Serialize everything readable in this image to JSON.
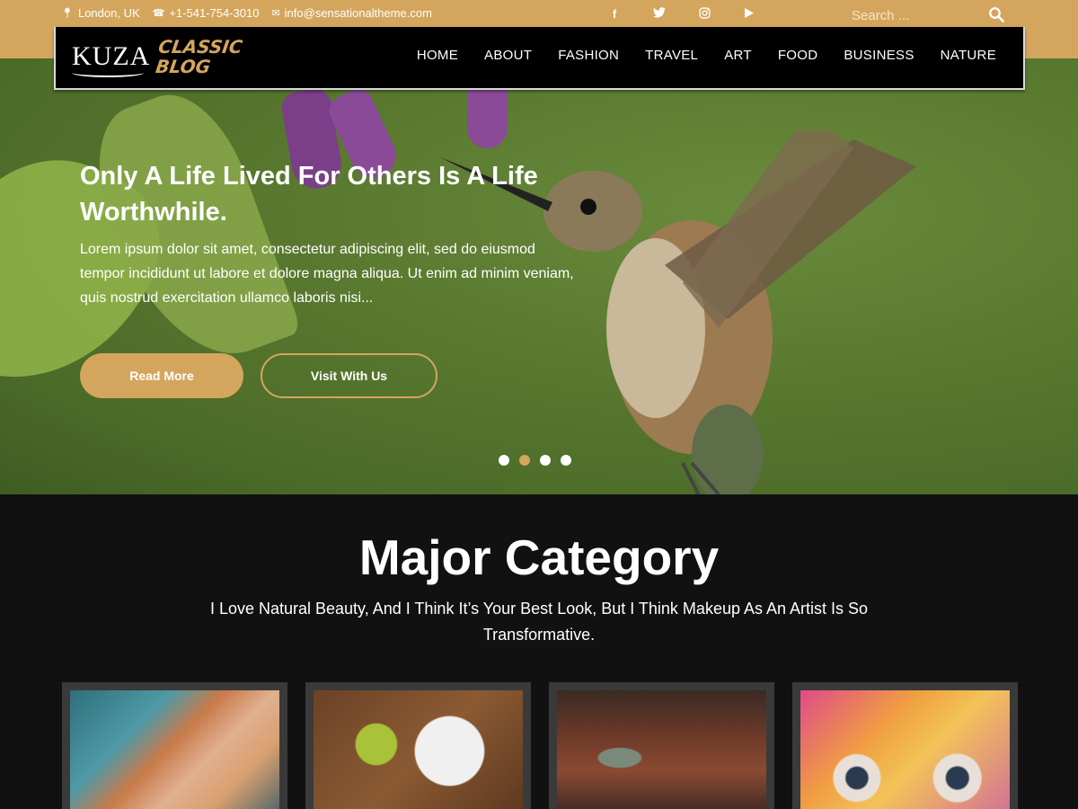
{
  "topbar": {
    "location": "London, UK",
    "phone": "+1-541-754-3010",
    "email": "info@sensationaltheme.com",
    "search_placeholder": "Search ...",
    "socials": [
      "facebook",
      "twitter",
      "instagram",
      "youtube"
    ]
  },
  "logo": {
    "primary": "KUZA",
    "secondary_line1": "CLASSIC",
    "secondary_line2": "BLOG"
  },
  "nav": {
    "items": [
      "HOME",
      "ABOUT",
      "FASHION",
      "TRAVEL",
      "ART",
      "FOOD",
      "BUSINESS",
      "NATURE"
    ]
  },
  "hero": {
    "title": "Only A Life Lived For Others Is A Life Worthwhile.",
    "text": "Lorem ipsum dolor sit amet, consectetur adipiscing elit, sed do eiusmod tempor incididunt ut labore et dolore magna aliqua. Ut enim ad minim veniam, quis nostrud exercitation ullamco laboris nisi...",
    "read_more": "Read More",
    "visit": "Visit With Us",
    "slides": 4,
    "active_slide": 2
  },
  "category": {
    "title": "Major Category",
    "subtitle": "I Love Natural Beauty, And I Think It’s Your Best Look, But I Think Makeup As An Artist Is So Transformative."
  },
  "colors": {
    "accent": "#d4a65d",
    "dark": "#111111",
    "nav_bg": "#000000"
  }
}
